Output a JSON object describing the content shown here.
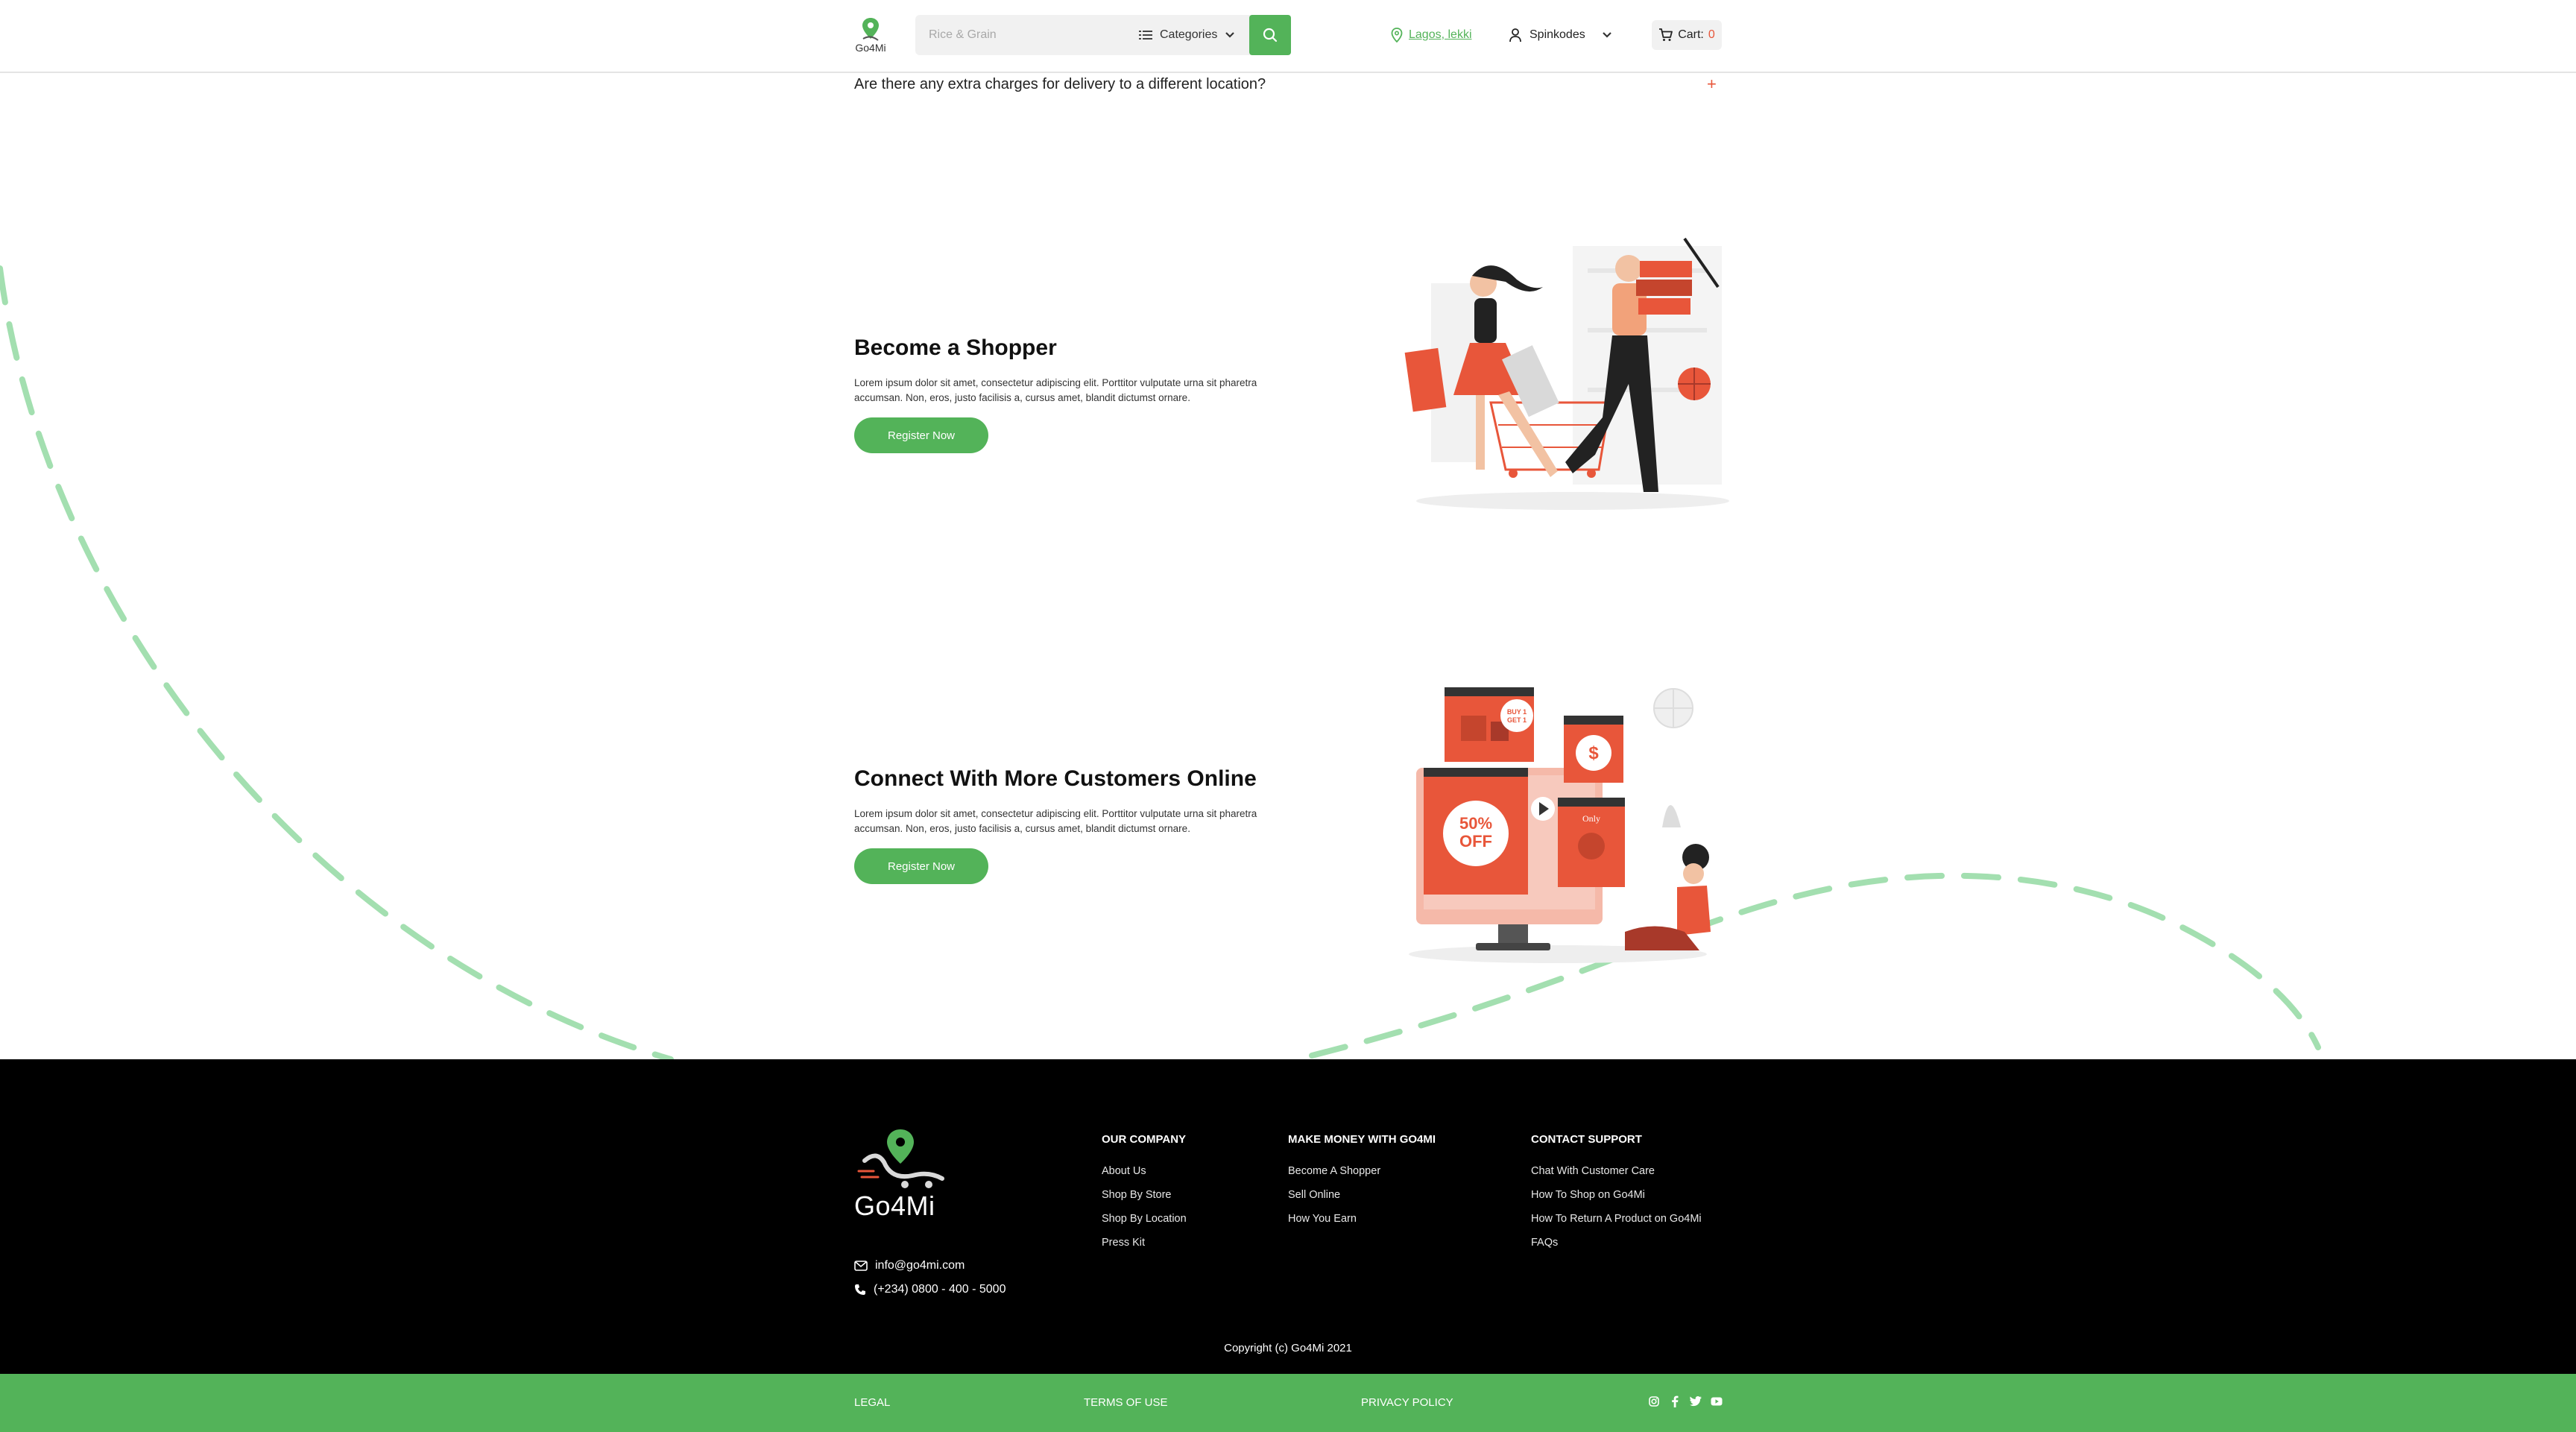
{
  "header": {
    "logo_text": "Go4Mi",
    "search_placeholder": "Rice & Grain",
    "categories_label": "Categories",
    "location_label": "Lagos, lekki",
    "user_label": "Spinkodes",
    "cart_label": "Cart:",
    "cart_count": "0"
  },
  "faq": {
    "question": "Are there any extra charges for delivery to a different location?",
    "toggle": "+"
  },
  "sections": [
    {
      "title": "Become a Shopper",
      "description": "Lorem ipsum dolor sit amet, consectetur adipiscing elit. Porttitor vulputate urna sit pharetra accumsan. Non, eros, justo facilisis a, cursus amet, blandit dictumst ornare.",
      "button": "Register Now"
    },
    {
      "title": "Connect With More Customers Online",
      "description": "Lorem ipsum dolor sit amet, consectetur adipiscing elit. Porttitor vulputate urna sit pharetra accumsan. Non, eros, justo facilisis a, cursus amet, blandit dictumst ornare.",
      "button": "Register Now"
    }
  ],
  "illustration_text": {
    "discount": "50% OFF",
    "discount_line1": "50%",
    "discount_line2": "OFF",
    "badge": "BUY 1 GET 1",
    "only": "Only",
    "currency": "$"
  },
  "footer": {
    "logo_text": "Go4Mi",
    "email": "info@go4mi.com",
    "phone": "(+234) 0800 - 400 - 5000",
    "columns": [
      {
        "title": "OUR COMPANY",
        "links": [
          "About Us",
          "Shop By Store",
          "Shop By Location",
          "Press Kit"
        ]
      },
      {
        "title": "MAKE MONEY WITH GO4MI",
        "links": [
          "Become A Shopper",
          "Sell Online",
          "How You Earn"
        ]
      },
      {
        "title": "CONTACT SUPPORT",
        "links": [
          "Chat With Customer Care",
          "How To Shop on Go4Mi",
          "How To Return A Product on Go4Mi",
          "FAQs"
        ]
      }
    ],
    "copyright": "Copyright (c) Go4Mi 2021"
  },
  "bottom_bar": {
    "legal": "LEGAL",
    "terms": "TERMS OF USE",
    "privacy": "PRIVACY POLICY",
    "social": [
      "instagram-icon",
      "facebook-icon",
      "twitter-icon",
      "youtube-icon"
    ]
  },
  "colors": {
    "brand_green": "#53b359",
    "accent_orange": "#e8563a",
    "dashed_curve": "#a3dfb0",
    "footer_bg": "#000000"
  }
}
